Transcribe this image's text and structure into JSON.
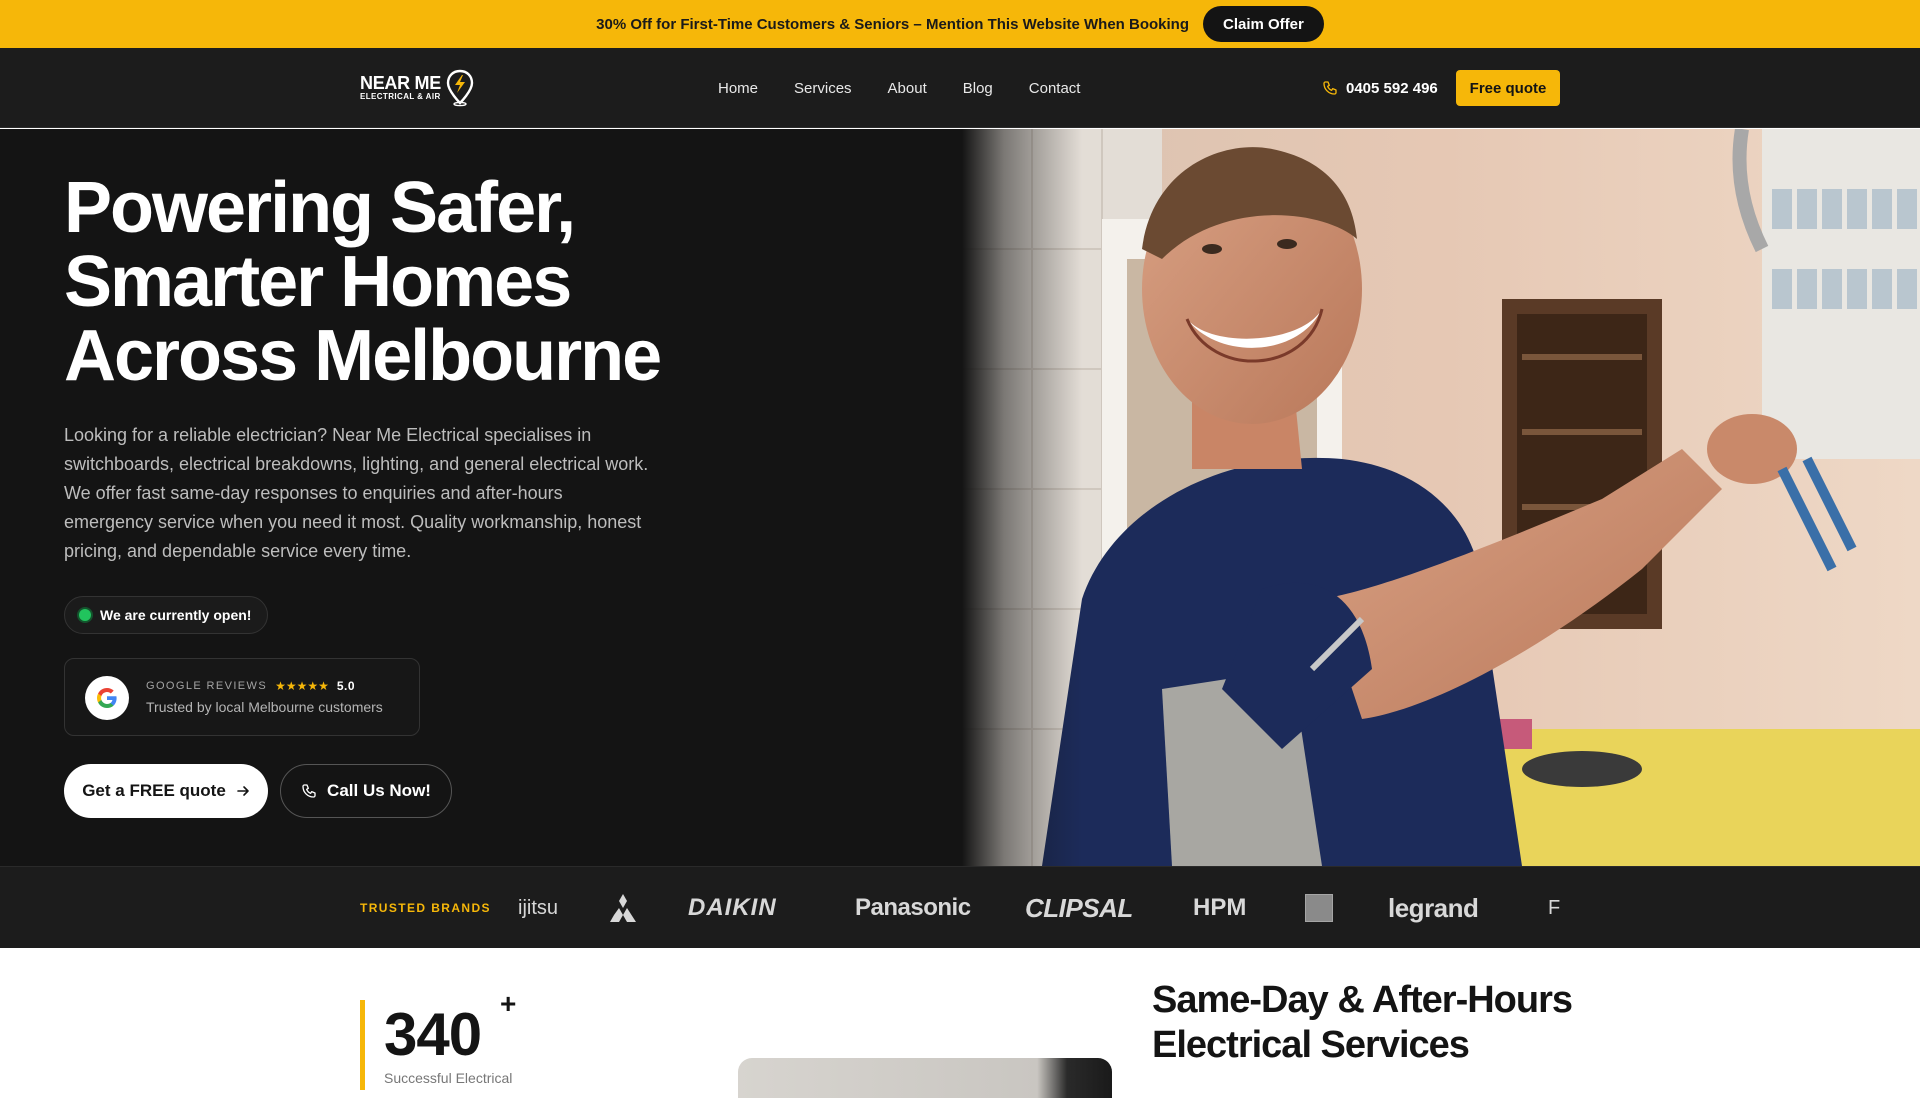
{
  "promo": {
    "text": "30% Off for First-Time Customers & Seniors – Mention This Website When Booking",
    "button": "Claim Offer"
  },
  "nav": {
    "logo_main": "NEAR ME",
    "logo_sub": "ELECTRICAL & AIR",
    "links": [
      "Home",
      "Services",
      "About",
      "Blog",
      "Contact"
    ],
    "phone": "0405 592 496",
    "quote_button": "Free quote"
  },
  "hero": {
    "title_lines": [
      "Powering Safer,",
      "Smarter Homes",
      "Across Melbourne"
    ],
    "description": "Looking for a reliable electrician? Near Me Electrical specialises in switchboards, electrical breakdowns, lighting, and general electrical work. We offer fast same-day responses to enquiries and after-hours emergency service when you need it most. Quality workmanship, honest pricing, and dependable service every time.",
    "open_status": "We are currently open!",
    "reviews": {
      "label": "GOOGLE REVIEWS",
      "stars": "★★★★★",
      "rating": "5.0",
      "subtitle": "Trusted by local Melbourne customers"
    },
    "cta_primary": "Get a FREE quote",
    "cta_secondary": "Call Us Now!"
  },
  "brands": {
    "label": "TRUSTED BRANDS",
    "items": [
      "ijitsu",
      "Mitsubishi",
      "DAIKIN",
      "Panasonic",
      "CLIPSAL",
      "HPM",
      "",
      "legrand",
      "FU"
    ]
  },
  "stats": {
    "number": "340",
    "suffix": "+",
    "label": "Successful Electrical"
  },
  "section": {
    "title": "Same-Day & After-Hours Electrical Services"
  },
  "colors": {
    "accent": "#f6b709",
    "dark": "#141414",
    "nav": "#1c1c1c",
    "open_green": "#21c45d"
  }
}
